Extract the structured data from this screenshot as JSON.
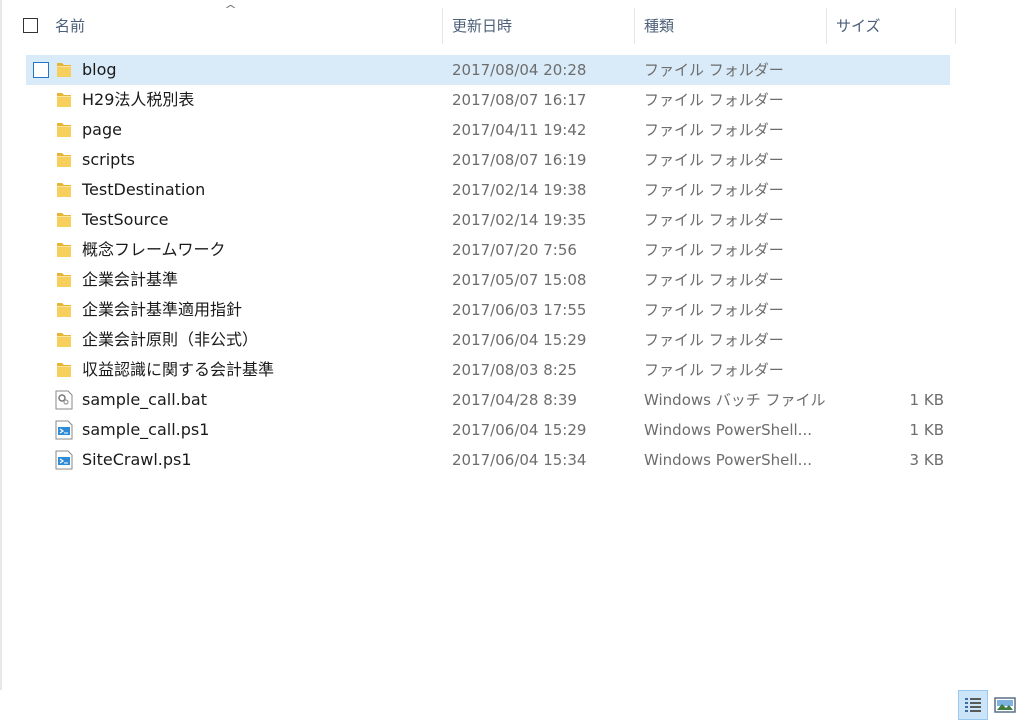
{
  "columns": {
    "name": "名前",
    "date": "更新日時",
    "type": "種類",
    "size": "サイズ"
  },
  "files": [
    {
      "name": "blog",
      "date": "2017/08/04 20:28",
      "type": "ファイル フォルダー",
      "size": "",
      "icon": "folder-icon",
      "selected": true
    },
    {
      "name": "H29法人税別表",
      "date": "2017/08/07 16:17",
      "type": "ファイル フォルダー",
      "size": "",
      "icon": "folder-icon"
    },
    {
      "name": "page",
      "date": "2017/04/11 19:42",
      "type": "ファイル フォルダー",
      "size": "",
      "icon": "folder-icon"
    },
    {
      "name": "scripts",
      "date": "2017/08/07 16:19",
      "type": "ファイル フォルダー",
      "size": "",
      "icon": "folder-icon"
    },
    {
      "name": "TestDestination",
      "date": "2017/02/14 19:38",
      "type": "ファイル フォルダー",
      "size": "",
      "icon": "folder-icon"
    },
    {
      "name": "TestSource",
      "date": "2017/02/14 19:35",
      "type": "ファイル フォルダー",
      "size": "",
      "icon": "folder-icon"
    },
    {
      "name": "概念フレームワーク",
      "date": "2017/07/20 7:56",
      "type": "ファイル フォルダー",
      "size": "",
      "icon": "folder-icon"
    },
    {
      "name": "企業会計基準",
      "date": "2017/05/07 15:08",
      "type": "ファイル フォルダー",
      "size": "",
      "icon": "folder-icon"
    },
    {
      "name": "企業会計基準適用指針",
      "date": "2017/06/03 17:55",
      "type": "ファイル フォルダー",
      "size": "",
      "icon": "folder-icon"
    },
    {
      "name": "企業会計原則（非公式）",
      "date": "2017/06/04 15:29",
      "type": "ファイル フォルダー",
      "size": "",
      "icon": "folder-icon"
    },
    {
      "name": "収益認識に関する会計基準",
      "date": "2017/08/03 8:25",
      "type": "ファイル フォルダー",
      "size": "",
      "icon": "folder-icon"
    },
    {
      "name": "sample_call.bat",
      "date": "2017/04/28 8:39",
      "type": "Windows バッチ ファイル",
      "size": "1 KB",
      "icon": "batch-file-icon"
    },
    {
      "name": "sample_call.ps1",
      "date": "2017/06/04 15:29",
      "type": "Windows PowerShell...",
      "size": "1 KB",
      "icon": "powershell-script-icon"
    },
    {
      "name": "SiteCrawl.ps1",
      "date": "2017/06/04 15:34",
      "type": "Windows PowerShell...",
      "size": "3 KB",
      "icon": "powershell-script-icon"
    }
  ],
  "colors": {
    "selection": "#d9ebf9",
    "checkbox": "#2178c8",
    "folder": "#f4c74e",
    "header_text": "#4c607a"
  }
}
